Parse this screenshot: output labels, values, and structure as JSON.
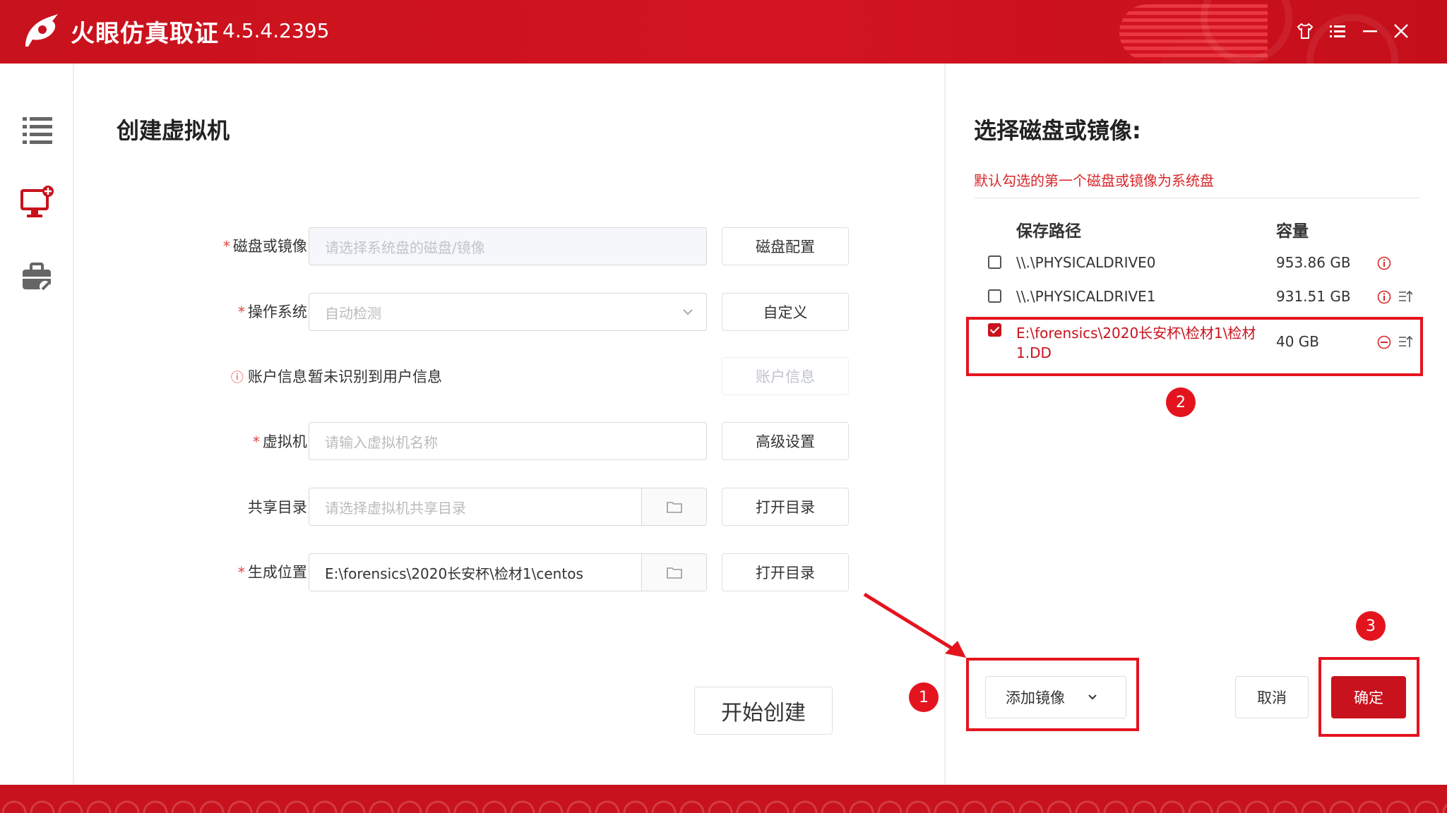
{
  "titlebar": {
    "app_name": "火眼仿真取证",
    "version": "4.5.4.2395",
    "accent_color": "#c8121d"
  },
  "sidenav": {
    "items": [
      {
        "icon": "list-icon"
      },
      {
        "icon": "monitor-add-icon",
        "active": true
      },
      {
        "icon": "toolbox-icon"
      }
    ]
  },
  "create_vm": {
    "title": "创建虚拟机",
    "fields": {
      "disk": {
        "label": "磁盘或镜像:",
        "placeholder": "请选择系统盘的磁盘/镜像",
        "button": "磁盘配置"
      },
      "os": {
        "label": "操作系统:",
        "placeholder": "自动检测",
        "button": "自定义"
      },
      "account": {
        "label": "账户信息:",
        "value": "暂未识别到用户信息",
        "button": "账户信息"
      },
      "vm": {
        "label": "虚拟机:",
        "placeholder": "请输入虚拟机名称",
        "button": "高级设置"
      },
      "share": {
        "label": "共享目录:",
        "placeholder": "请选择虚拟机共享目录",
        "button": "打开目录"
      },
      "output": {
        "label": "生成位置:",
        "value": "E:\\forensics\\2020长安杯\\检材1\\centos",
        "button": "打开目录"
      }
    },
    "start_button": "开始创建"
  },
  "disk_select": {
    "title": "选择磁盘或镜像:",
    "hint": "默认勾选的第一个磁盘或镜像为系统盘",
    "columns": {
      "path": "保存路径",
      "capacity": "容量"
    },
    "rows": [
      {
        "path": "\\\\.\\PHYSICALDRIVE0",
        "capacity": "953.86 GB",
        "checked": false
      },
      {
        "path": "\\\\.\\PHYSICALDRIVE1",
        "capacity": "931.51 GB",
        "checked": false
      },
      {
        "path_line1": "E:\\forensics\\2020长安杯\\检材1\\检材",
        "path_line2": "1.DD",
        "capacity": "40 GB",
        "checked": true
      }
    ],
    "add_image_button": "添加镜像",
    "cancel_button": "取消",
    "ok_button": "确定"
  },
  "annotations": {
    "badge1": "1",
    "badge2": "2",
    "badge3": "3",
    "color": "#e4141f"
  }
}
